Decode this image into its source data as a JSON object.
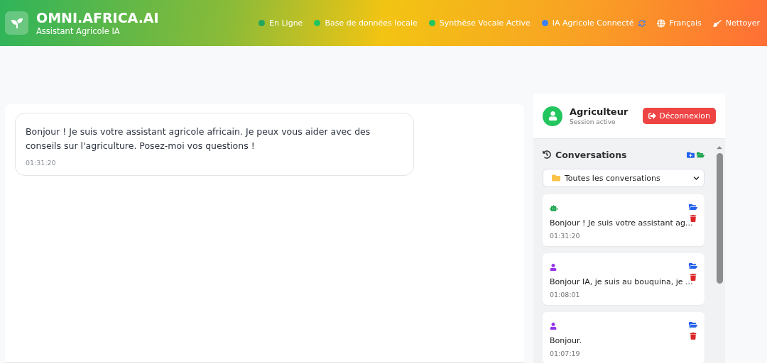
{
  "brand": {
    "title": "OMNI.AFRICA.AI",
    "subtitle": "Assistant Agricole IA"
  },
  "statuses": [
    {
      "label": "En Ligne",
      "color": "#22a55e",
      "sync": false
    },
    {
      "label": "Base de données locale",
      "color": "#22c55e",
      "sync": false
    },
    {
      "label": "Synthèse Vocale Active",
      "color": "#22c55e",
      "sync": false
    },
    {
      "label": "IA Agricole Connecté",
      "color": "#3b82f6",
      "sync": true
    }
  ],
  "actions": [
    {
      "kind": "language",
      "label": "Français"
    },
    {
      "kind": "clean",
      "label": "Nettoyer"
    }
  ],
  "messages": [
    {
      "text": "Bonjour ! Je suis votre assistant agricole africain. Je peux vous aider avec des conseils sur l'agriculture. Posez-moi vos questions !",
      "time": "01:31:20"
    }
  ],
  "user": {
    "name": "Agriculteur",
    "status": "Session active",
    "logout": "Déconnexion"
  },
  "conversations": {
    "title": "Conversations",
    "filter": "Toutes les conversations",
    "items": [
      {
        "kind": "bot",
        "preview": "Bonjour ! Je suis votre assistant ag...",
        "time": "01:31:20"
      },
      {
        "kind": "user",
        "preview": "Bonjour IA, je suis au bouquina, je ...",
        "time": "01:08:01"
      },
      {
        "kind": "user",
        "preview": "Bonjour.",
        "time": "01:07:19"
      }
    ]
  }
}
